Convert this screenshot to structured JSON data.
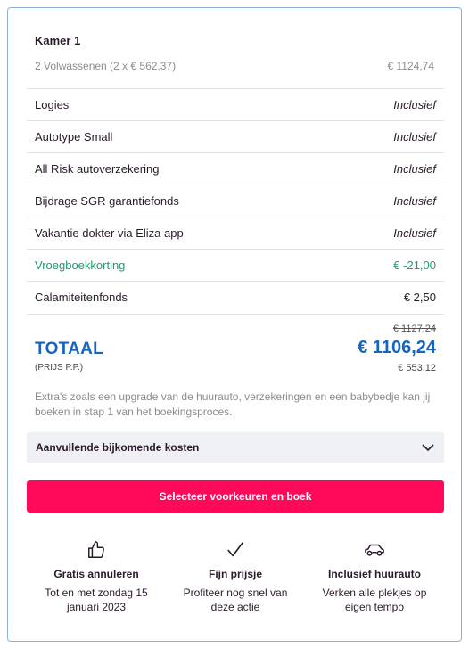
{
  "room": {
    "title": "Kamer 1",
    "occupants": "2 Volwassenen (2 x € 562,37)",
    "occupants_price": "€ 1124,74"
  },
  "line_items": [
    {
      "label": "Logies",
      "value": "Inclusief",
      "kind": "included"
    },
    {
      "label": "Autotype Small",
      "value": "Inclusief",
      "kind": "included"
    },
    {
      "label": "All Risk autoverzekering",
      "value": "Inclusief",
      "kind": "included"
    },
    {
      "label": "Bijdrage SGR garantiefonds",
      "value": "Inclusief",
      "kind": "included"
    },
    {
      "label": "Vakantie dokter via Eliza app",
      "value": "Inclusief",
      "kind": "included"
    },
    {
      "label": "Vroegboekkorting",
      "value": "€ -21,00",
      "kind": "discount"
    },
    {
      "label": "Calamiteitenfonds",
      "value": "€ 2,50",
      "kind": "plain"
    }
  ],
  "total": {
    "old_price": "€ 1127,24",
    "label": "TOTAAL",
    "price": "€ 1106,24",
    "per_person_label": "(PRIJS P.P.)",
    "per_person_price": "€ 553,12"
  },
  "extras_note": "Extra's zoals een upgrade van de huurauto, verzekeringen en een babybedje kan jij boeken in stap 1 van het boekingsproces.",
  "accordion": {
    "label": "Aanvullende bijkomende kosten"
  },
  "cta": {
    "label": "Selecteer voorkeuren en boek"
  },
  "features": [
    {
      "icon": "thumbs-up-icon",
      "title": "Gratis annuleren",
      "desc": "Tot en met zondag 15 januari 2023"
    },
    {
      "icon": "checkmark-icon",
      "title": "Fijn prijsje",
      "desc": "Profiteer nog snel van deze actie"
    },
    {
      "icon": "car-icon",
      "title": "Inclusief huurauto",
      "desc": "Verken alle plekjes op eigen tempo"
    }
  ],
  "colors": {
    "accent": "#ff0a5a",
    "total": "#1565c0",
    "discount": "#1a9e6a",
    "border": "#8fb0d8"
  }
}
